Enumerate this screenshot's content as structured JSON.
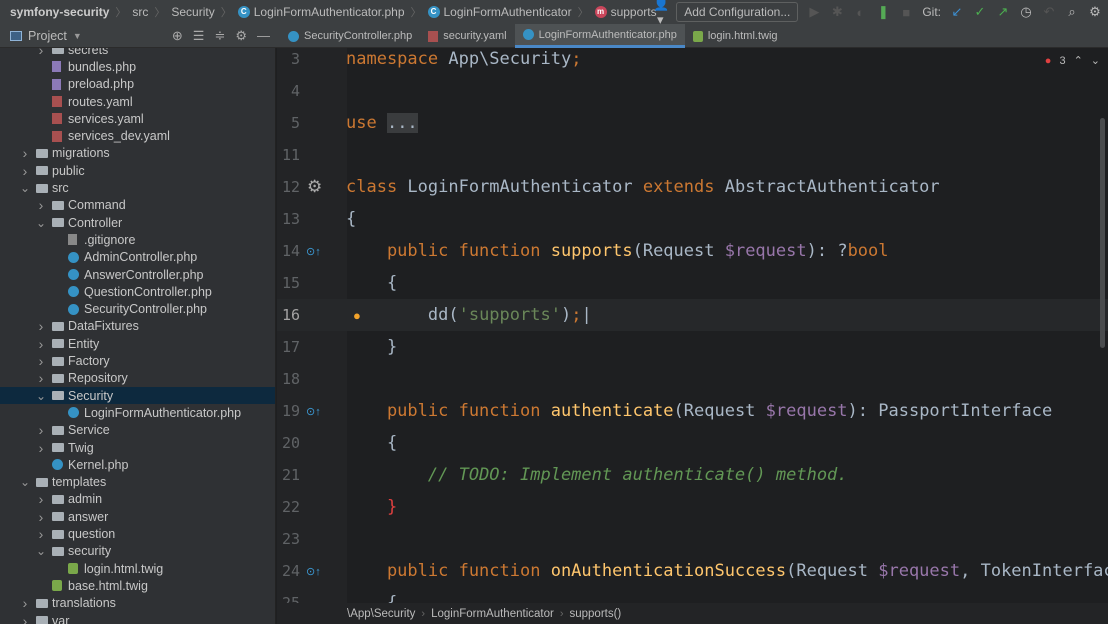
{
  "breadcrumb": [
    "symfony-security",
    "src",
    "Security",
    "LoginFormAuthenticator.php",
    "LoginFormAuthenticator",
    "supports"
  ],
  "toolbar": {
    "add_config": "Add Configuration...",
    "git_label": "Git:"
  },
  "project": {
    "title": "Project"
  },
  "tabs": [
    {
      "label": "SecurityController.php",
      "icon": "php"
    },
    {
      "label": "security.yaml",
      "icon": "yaml"
    },
    {
      "label": "LoginFormAuthenticator.php",
      "icon": "php",
      "active": true
    },
    {
      "label": "login.html.twig",
      "icon": "twig"
    }
  ],
  "tree": [
    {
      "label": "secrets",
      "type": "folder",
      "depth": 2,
      "state": "collapsed"
    },
    {
      "label": "bundles.php",
      "type": "php-file",
      "depth": 2
    },
    {
      "label": "preload.php",
      "type": "php-file",
      "depth": 2
    },
    {
      "label": "routes.yaml",
      "type": "yaml",
      "depth": 2
    },
    {
      "label": "services.yaml",
      "type": "yaml",
      "depth": 2
    },
    {
      "label": "services_dev.yaml",
      "type": "yaml",
      "depth": 2
    },
    {
      "label": "migrations",
      "type": "folder",
      "depth": 1,
      "state": "collapsed"
    },
    {
      "label": "public",
      "type": "folder",
      "depth": 1,
      "state": "collapsed"
    },
    {
      "label": "src",
      "type": "folder",
      "depth": 1,
      "state": "expanded"
    },
    {
      "label": "Command",
      "type": "folder",
      "depth": 2,
      "state": "collapsed"
    },
    {
      "label": "Controller",
      "type": "folder",
      "depth": 2,
      "state": "expanded"
    },
    {
      "label": ".gitignore",
      "type": "gi",
      "depth": 3
    },
    {
      "label": "AdminController.php",
      "type": "php",
      "depth": 3
    },
    {
      "label": "AnswerController.php",
      "type": "php",
      "depth": 3
    },
    {
      "label": "QuestionController.php",
      "type": "php",
      "depth": 3
    },
    {
      "label": "SecurityController.php",
      "type": "php",
      "depth": 3
    },
    {
      "label": "DataFixtures",
      "type": "folder",
      "depth": 2,
      "state": "collapsed"
    },
    {
      "label": "Entity",
      "type": "folder",
      "depth": 2,
      "state": "collapsed"
    },
    {
      "label": "Factory",
      "type": "folder",
      "depth": 2,
      "state": "collapsed"
    },
    {
      "label": "Repository",
      "type": "folder",
      "depth": 2,
      "state": "collapsed"
    },
    {
      "label": "Security",
      "type": "folder",
      "depth": 2,
      "state": "expanded",
      "selected": true
    },
    {
      "label": "LoginFormAuthenticator.php",
      "type": "php",
      "depth": 3
    },
    {
      "label": "Service",
      "type": "folder",
      "depth": 2,
      "state": "collapsed"
    },
    {
      "label": "Twig",
      "type": "folder",
      "depth": 2,
      "state": "collapsed"
    },
    {
      "label": "Kernel.php",
      "type": "php",
      "depth": 2
    },
    {
      "label": "templates",
      "type": "folder",
      "depth": 1,
      "state": "expanded"
    },
    {
      "label": "admin",
      "type": "folder",
      "depth": 2,
      "state": "collapsed"
    },
    {
      "label": "answer",
      "type": "folder",
      "depth": 2,
      "state": "collapsed"
    },
    {
      "label": "question",
      "type": "folder",
      "depth": 2,
      "state": "collapsed"
    },
    {
      "label": "security",
      "type": "folder",
      "depth": 2,
      "state": "expanded"
    },
    {
      "label": "login.html.twig",
      "type": "twig",
      "depth": 3
    },
    {
      "label": "base.html.twig",
      "type": "twig",
      "depth": 2
    },
    {
      "label": "translations",
      "type": "folder",
      "depth": 1,
      "state": "collapsed"
    },
    {
      "label": "var",
      "type": "folder",
      "depth": 1,
      "state": "collapsed"
    }
  ],
  "editor": {
    "error_count": "3",
    "lines": [
      {
        "n": "3",
        "t": [
          [
            "namespace ",
            "kw"
          ],
          [
            "App\\Security",
            ""
          ],
          [
            ";",
            "kw"
          ]
        ]
      },
      {
        "n": "4",
        "t": []
      },
      {
        "n": "5",
        "t": [
          [
            "use ",
            "kw"
          ],
          [
            "...",
            "fold"
          ]
        ]
      },
      {
        "n": "11",
        "t": []
      },
      {
        "n": "12",
        "t": [
          [
            "class ",
            "kw"
          ],
          [
            "LoginFormAuthenticator ",
            ""
          ],
          [
            "extends ",
            "kw"
          ],
          [
            "AbstractAuthenticator",
            ""
          ]
        ],
        "gear": true
      },
      {
        "n": "13",
        "t": [
          [
            "{",
            ""
          ]
        ]
      },
      {
        "n": "14",
        "t": [
          [
            "    public function ",
            "kw"
          ],
          [
            "supports",
            "fn"
          ],
          [
            "(Request ",
            ""
          ],
          [
            "$request",
            "var"
          ],
          [
            "): ?",
            ""
          ],
          [
            "bool",
            "kw"
          ]
        ],
        "impl": true
      },
      {
        "n": "15",
        "t": [
          [
            "    {",
            ""
          ]
        ]
      },
      {
        "n": "16",
        "t": [
          [
            "        dd(",
            ""
          ],
          [
            "'supports'",
            "str"
          ],
          [
            ")",
            ""
          ],
          [
            ";",
            "kw"
          ],
          [
            "|",
            ""
          ]
        ],
        "current": true,
        "bulb": true
      },
      {
        "n": "17",
        "t": [
          [
            "    }",
            ""
          ]
        ]
      },
      {
        "n": "18",
        "t": []
      },
      {
        "n": "19",
        "t": [
          [
            "    public function ",
            "kw"
          ],
          [
            "authenticate",
            "fn"
          ],
          [
            "(Request ",
            ""
          ],
          [
            "$request",
            "var"
          ],
          [
            "): PassportInterface",
            ""
          ]
        ],
        "impl": true
      },
      {
        "n": "20",
        "t": [
          [
            "    {",
            ""
          ]
        ]
      },
      {
        "n": "21",
        "t": [
          [
            "        // ",
            "cm"
          ],
          [
            "TODO: Implement authenticate() method.",
            "cm"
          ]
        ]
      },
      {
        "n": "22",
        "t": [
          [
            "    }",
            "red"
          ]
        ]
      },
      {
        "n": "23",
        "t": []
      },
      {
        "n": "24",
        "t": [
          [
            "    public function ",
            "kw"
          ],
          [
            "onAuthenticationSuccess",
            "fn"
          ],
          [
            "(Request ",
            ""
          ],
          [
            "$request",
            "var"
          ],
          [
            ", TokenInterface",
            ""
          ]
        ],
        "impl": true
      },
      {
        "n": "25",
        "t": [
          [
            "    {",
            ""
          ]
        ]
      }
    ]
  },
  "status": {
    "crumbs": [
      "\\App\\Security",
      "LoginFormAuthenticator",
      "supports()"
    ]
  }
}
